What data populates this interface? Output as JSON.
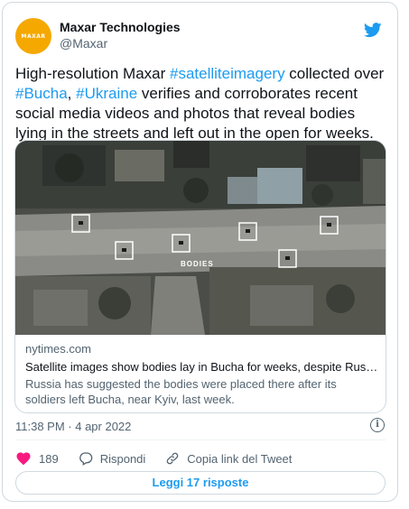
{
  "author": {
    "avatar_text": "MAXAR",
    "name": "Maxar Technologies",
    "handle": "@Maxar"
  },
  "tweet": {
    "t1": "High-resolution Maxar ",
    "tag1": "#satelliteimagery",
    "t2": " collected over ",
    "tag2": "#Bucha",
    "t3": ", ",
    "tag3": "#Ukraine",
    "t4": " verifies and corroborates recent social media videos and photos that reveal bodies lying in the streets and left out in the open for weeks."
  },
  "card": {
    "image_label": "BODIES",
    "domain": "nytimes.com",
    "title": "Satellite images show bodies lay in Bucha for weeks, despite Russian ...",
    "description": "Russia has suggested the bodies were placed there after its soldiers left Bucha, near Kyiv, last week."
  },
  "meta": {
    "timestamp": "11:38 PM · 4 apr 2022"
  },
  "actions": {
    "like_count": "189",
    "reply_label": "Rispondi",
    "copy_label": "Copia link del Tweet"
  },
  "read_replies": "Leggi 17 risposte",
  "colors": {
    "link": "#1d9bf0",
    "like": "#f91880",
    "brand": "#f5a800"
  },
  "icons": [
    "twitter-bird-icon",
    "info-icon",
    "heart-icon",
    "reply-icon",
    "link-icon"
  ]
}
